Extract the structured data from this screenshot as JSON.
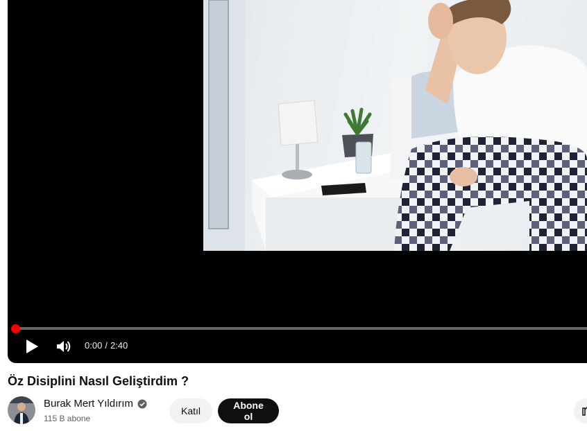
{
  "player": {
    "current_time": "0:00",
    "time_separator": "/",
    "duration": "2:40",
    "progress": 0,
    "icons": {
      "play": "play-icon",
      "volume": "volume-icon"
    },
    "accent_color": "#ff0000"
  },
  "video": {
    "title": "Öz Disiplini Nasıl Geliştirdim ?"
  },
  "channel": {
    "name": "Burak Mert Yıldırım",
    "verified_icon": "verified-check-icon",
    "subscribers": "115 B abone"
  },
  "actions": {
    "join_label": "Katıl",
    "subscribe_label": "Abone ol",
    "like_icon": "thumbs-up-icon"
  }
}
